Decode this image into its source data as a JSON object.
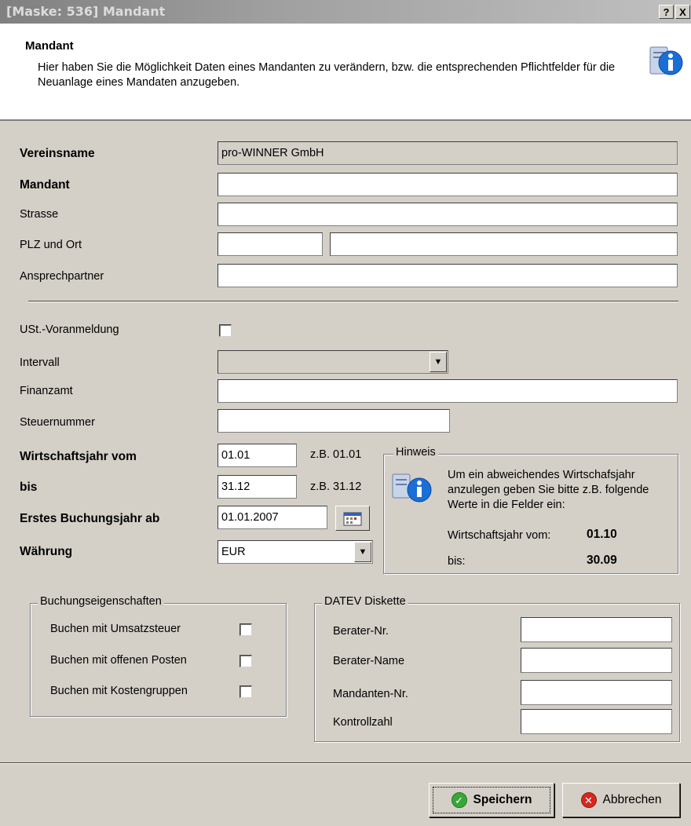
{
  "window": {
    "title": "[Maske: 536] Mandant",
    "help_label": "?",
    "close_label": "X"
  },
  "header": {
    "title": "Mandant",
    "description": "Hier haben Sie die Möglichkeit Daten eines Mandanten zu verändern, bzw. die entsprechenden Pflichtfelder für die Neuanlage eines Mandaten anzugeben.",
    "icon": "info-icon"
  },
  "form": {
    "vereinsname": {
      "label": "Vereinsname",
      "value": "pro-WINNER GmbH"
    },
    "mandant": {
      "label": "Mandant",
      "value": ""
    },
    "strasse": {
      "label": "Strasse",
      "value": ""
    },
    "plz_ort": {
      "label": "PLZ und Ort",
      "plz": "",
      "ort": ""
    },
    "ansprechpartner": {
      "label": "Ansprechpartner",
      "value": ""
    },
    "ust": {
      "label": "USt.-Voranmeldung",
      "checked": false
    },
    "intervall": {
      "label": "Intervall",
      "value": ""
    },
    "finanzamt": {
      "label": "Finanzamt",
      "value": ""
    },
    "steuernummer": {
      "label": "Steuernummer",
      "value": ""
    },
    "wj_vom": {
      "label": "Wirtschaftsjahr vom",
      "value": "01.01",
      "hint": "z.B. 01.01"
    },
    "wj_bis": {
      "label": "bis",
      "value": "31.12",
      "hint": "z.B. 31.12"
    },
    "erstes_buchungsjahr": {
      "label": "Erstes Buchungsjahr ab",
      "value": "01.01.2007"
    },
    "waehrung": {
      "label": "Währung",
      "value": "EUR"
    }
  },
  "hinweis": {
    "title": "Hinweis",
    "text": "Um ein abweichendes Wirtschafsjahr anzulegen geben Sie bitte z.B. folgende Werte in die Felder ein:",
    "row1_label": "Wirtschaftsjahr vom:",
    "row1_value": "01.10",
    "row2_label": "bis:",
    "row2_value": "30.09"
  },
  "buchung": {
    "title": "Buchungseigenschaften",
    "items": [
      {
        "label": "Buchen mit Umsatzsteuer",
        "checked": false
      },
      {
        "label": "Buchen mit offenen Posten",
        "checked": false
      },
      {
        "label": "Buchen mit Kostengruppen",
        "checked": false
      }
    ]
  },
  "datev": {
    "title": "DATEV Diskette",
    "fields": [
      {
        "label": "Berater-Nr.",
        "value": ""
      },
      {
        "label": "Berater-Name",
        "value": ""
      },
      {
        "label": "Mandanten-Nr.",
        "value": ""
      },
      {
        "label": "Kontrollzahl",
        "value": ""
      }
    ]
  },
  "buttons": {
    "save": "Speichern",
    "cancel": "Abbrechen"
  },
  "colors": {
    "window_bg": "#d4d0c8",
    "save_icon": "#3aa63a",
    "cancel_icon": "#d9261c",
    "info_icon": "#1a6fd6"
  }
}
